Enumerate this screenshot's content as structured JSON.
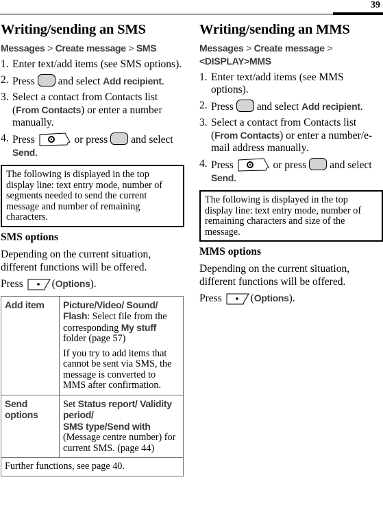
{
  "page_number": "39",
  "sms": {
    "title": "Writing/sending an SMS",
    "path": [
      "Messages",
      "Create message",
      "SMS"
    ],
    "path_sep": " > ",
    "steps": [
      {
        "num": "1.",
        "text": "Enter text/add items (see SMS options)."
      },
      {
        "num": "2.",
        "pre": "Press",
        "post": "and select",
        "ui": "Add recipient",
        "end": "."
      },
      {
        "num": "3.",
        "pre": "Select a contact from Contacts list (",
        "ui": "From Contacts",
        "post": ") or enter a number manually."
      },
      {
        "num": "4.",
        "pre": "Press",
        "mid": "or press",
        "post": "and select",
        "ui": "Send",
        "end": "."
      }
    ],
    "note": "The following is displayed in the top display line: text entry mode, number of segments needed to send the current message and number of remaining characters.",
    "options_heading": "SMS options",
    "options_intro": "Depending on the current situation, different functions will be offered.",
    "press_label": "Press",
    "options_open": "(",
    "options_label": "Options",
    "options_close": ").",
    "table": {
      "add_item": {
        "label": "Add item",
        "ui1": "Picture",
        "sep1": "/",
        "ui2": "Video",
        "sep2": "/ ",
        "ui3": "Sound",
        "sep3": "/ ",
        "ui4": "Flash",
        "text1": ": Select file from the corresponding ",
        "ui5": "My stuff",
        "text2": " folder (page 57)",
        "text3": "If you try to add items that cannot be sent via SMS, the message is converted to MMS after confirmation."
      },
      "send_options": {
        "label": "Send options",
        "text1": "Set ",
        "ui1": "Status report",
        "sep1": "/ ",
        "ui2": "Validity period",
        "sep2": "/",
        "ui3": "SMS type",
        "sep3": "/",
        "ui4": "Send with",
        "text2": " (Message centre number) for current SMS. (page 44)"
      },
      "footer": "Further functions, see page 40."
    }
  },
  "mms": {
    "title": "Writing/sending an MMS",
    "path": [
      "Messages",
      "Create message",
      "<DISPLAY>MMS"
    ],
    "path_sep": " > ",
    "steps": [
      {
        "num": "1.",
        "text": "Enter text/add items (see MMS options)."
      },
      {
        "num": "2.",
        "pre": "Press",
        "post": "and select",
        "ui": "Add recipient",
        "end": "."
      },
      {
        "num": "3.",
        "pre": "Select a contact from Contacts list (",
        "ui": "From Contacts",
        "post": ") or enter a number/e-mail address manually."
      },
      {
        "num": "4.",
        "pre": "Press",
        "mid": "or press",
        "post": "and select",
        "ui": "Send",
        "end": "."
      }
    ],
    "note": "The following is displayed in the top display line: text entry mode, number of remaining characters and size of the message.",
    "options_heading": "MMS options",
    "options_intro": "Depending on the current situation, different functions will be offered.",
    "press_label": "Press",
    "options_open": "(",
    "options_label": "Options",
    "options_close": ")."
  }
}
